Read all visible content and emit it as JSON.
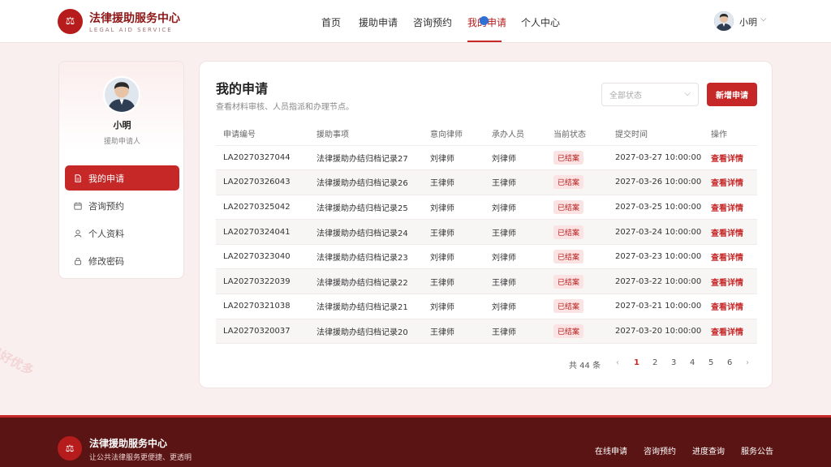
{
  "header": {
    "brand_title": "法律援助服务中心",
    "brand_sub": "LEGAL AID SERVICE",
    "logo_icon": "⚖",
    "nav": [
      {
        "label": "首页",
        "active": false
      },
      {
        "label": "援助申请",
        "active": false
      },
      {
        "label": "咨询预约",
        "active": false
      },
      {
        "label": "我的申请",
        "active": true
      },
      {
        "label": "个人中心",
        "active": false
      }
    ],
    "user_name": "小明",
    "user_chevron": "⌵"
  },
  "sidebar": {
    "name": "小明",
    "role": "援助申请人",
    "items": [
      {
        "label": "我的申请",
        "icon": "document-icon",
        "active": true
      },
      {
        "label": "咨询预约",
        "icon": "calendar-icon",
        "active": false
      },
      {
        "label": "个人资料",
        "icon": "user-icon",
        "active": false
      },
      {
        "label": "修改密码",
        "icon": "lock-icon",
        "active": false
      }
    ]
  },
  "main": {
    "title": "我的申请",
    "subtitle": "查看材料审核、人员指派和办理节点。",
    "filter_placeholder": "全部状态",
    "filter_chevron": "⌵",
    "new_button": "新增申请",
    "columns": [
      "申请编号",
      "援助事项",
      "意向律师",
      "承办人员",
      "当前状态",
      "提交时间",
      "操作"
    ],
    "rows": [
      {
        "id": "LA20270327044",
        "matter": "法律援助办结归档记录27",
        "lawyer": "刘律师",
        "handler": "刘律师",
        "status": "已结案",
        "time": "2027-03-27 10:00:00",
        "action": "查看详情"
      },
      {
        "id": "LA20270326043",
        "matter": "法律援助办结归档记录26",
        "lawyer": "王律师",
        "handler": "王律师",
        "status": "已结案",
        "time": "2027-03-26 10:00:00",
        "action": "查看详情"
      },
      {
        "id": "LA20270325042",
        "matter": "法律援助办结归档记录25",
        "lawyer": "刘律师",
        "handler": "刘律师",
        "status": "已结案",
        "time": "2027-03-25 10:00:00",
        "action": "查看详情"
      },
      {
        "id": "LA20270324041",
        "matter": "法律援助办结归档记录24",
        "lawyer": "王律师",
        "handler": "王律师",
        "status": "已结案",
        "time": "2027-03-24 10:00:00",
        "action": "查看详情"
      },
      {
        "id": "LA20270323040",
        "matter": "法律援助办结归档记录23",
        "lawyer": "刘律师",
        "handler": "刘律师",
        "status": "已结案",
        "time": "2027-03-23 10:00:00",
        "action": "查看详情"
      },
      {
        "id": "LA20270322039",
        "matter": "法律援助办结归档记录22",
        "lawyer": "王律师",
        "handler": "王律师",
        "status": "已结案",
        "time": "2027-03-22 10:00:00",
        "action": "查看详情"
      },
      {
        "id": "LA20270321038",
        "matter": "法律援助办结归档记录21",
        "lawyer": "刘律师",
        "handler": "刘律师",
        "status": "已结案",
        "time": "2027-03-21 10:00:00",
        "action": "查看详情"
      },
      {
        "id": "LA20270320037",
        "matter": "法律援助办结归档记录20",
        "lawyer": "王律师",
        "handler": "王律师",
        "status": "已结案",
        "time": "2027-03-20 10:00:00",
        "action": "查看详情"
      }
    ],
    "pager": {
      "total": "共 44 条",
      "prev": "‹",
      "next": "›",
      "pages": [
        "1",
        "2",
        "3",
        "4",
        "5",
        "6"
      ],
      "current": "1"
    }
  },
  "footer": {
    "title": "法律援助服务中心",
    "subtitle": "让公共法律服务更便捷、更透明",
    "links": [
      "在线申请",
      "咨询预约",
      "进度查询",
      "服务公告"
    ]
  },
  "watermark": "源码好优多",
  "colors": {
    "brand": "#b71c1c",
    "accent": "#c62828",
    "footer_bg": "#5a1414",
    "page_bg": "#f8efee"
  }
}
